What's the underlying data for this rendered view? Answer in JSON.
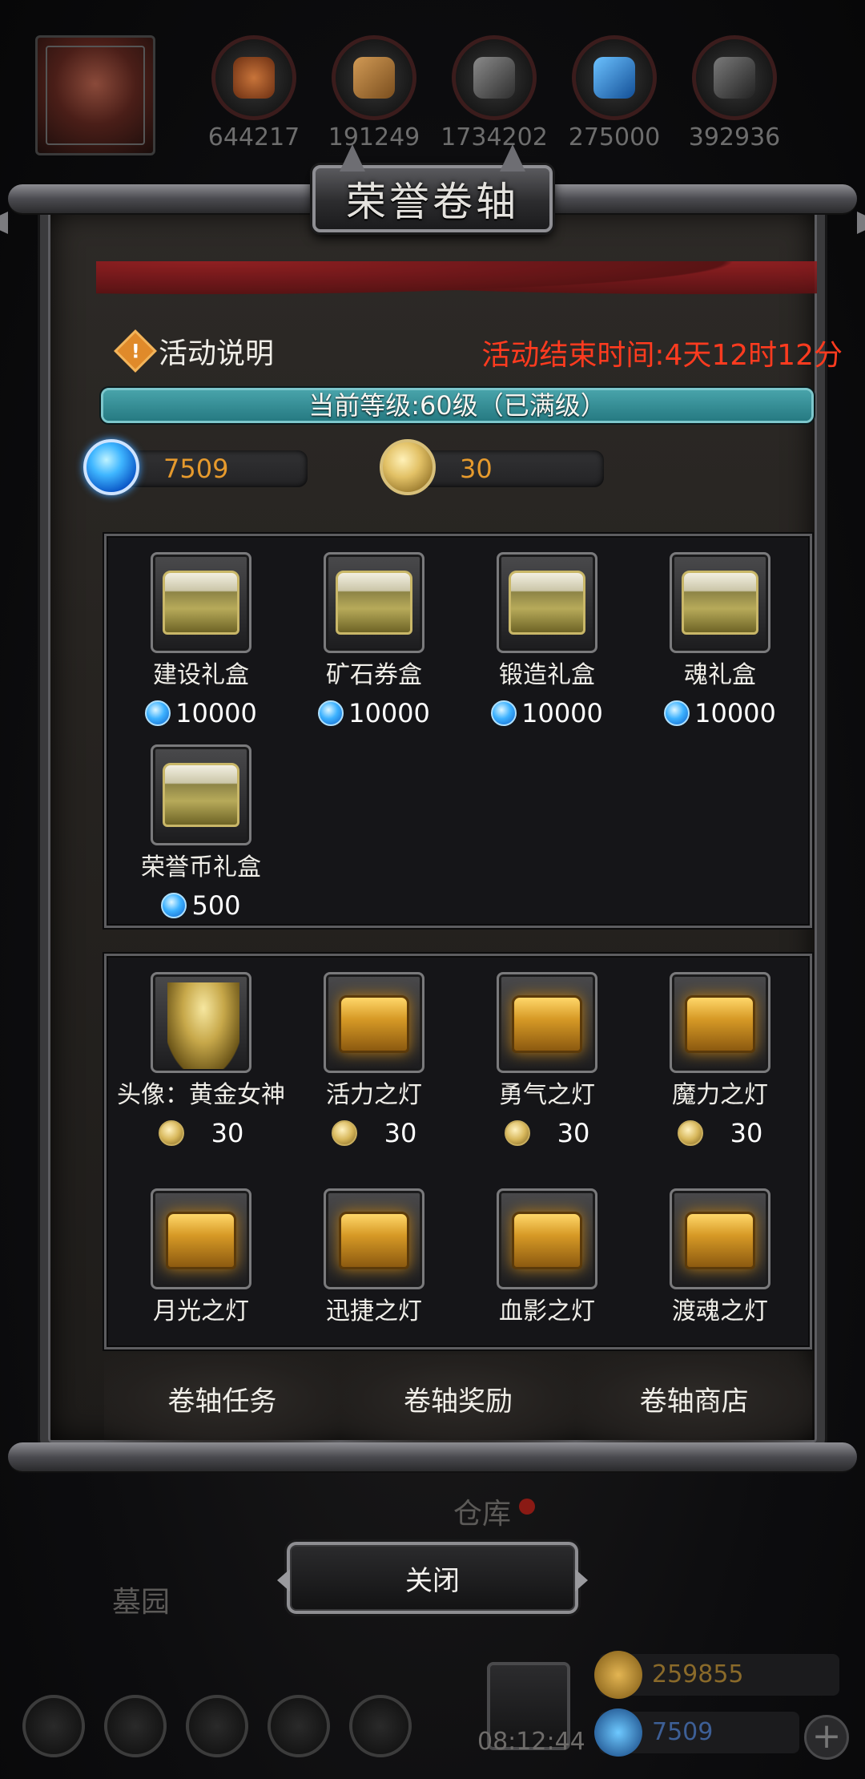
{
  "top_resources": [
    {
      "icon": "meat-icon",
      "value": "644217",
      "color": "#b05a2a"
    },
    {
      "icon": "wood-icon",
      "value": "191249",
      "color": "#a8793a"
    },
    {
      "icon": "iron-icon",
      "value": "1734202",
      "color": "#6b6b6b"
    },
    {
      "icon": "crystal-icon",
      "value": "275000",
      "color": "#3a8bd8"
    },
    {
      "icon": "steel-icon",
      "value": "392936",
      "color": "#5a5a5a"
    }
  ],
  "dialog": {
    "title": "荣誉卷轴",
    "info_label": "活动说明",
    "end_time": "活动结束时间:4天12时12分",
    "level_text": "当前等级:60级（已满级）",
    "level_progress": 1.0,
    "gems": "7509",
    "honor_coins": "30"
  },
  "gem_shop": [
    {
      "name": "建设礼盒",
      "price": "10000"
    },
    {
      "name": "矿石券盒",
      "price": "10000"
    },
    {
      "name": "锻造礼盒",
      "price": "10000"
    },
    {
      "name": "魂礼盒",
      "price": "10000"
    },
    {
      "name": "荣誉币礼盒",
      "price": "500"
    }
  ],
  "coin_shop": [
    {
      "name": "头像：黄金女神",
      "price": "30",
      "icon": "angel-statue-icon"
    },
    {
      "name": "活力之灯",
      "price": "30",
      "icon": "gold-chest-icon"
    },
    {
      "name": "勇气之灯",
      "price": "30",
      "icon": "gold-chest-icon"
    },
    {
      "name": "魔力之灯",
      "price": "30",
      "icon": "gold-chest-icon"
    },
    {
      "name": "月光之灯",
      "icon": "gold-chest-icon"
    },
    {
      "name": "迅捷之灯",
      "icon": "gold-chest-icon"
    },
    {
      "name": "血影之灯",
      "icon": "gold-chest-icon"
    },
    {
      "name": "渡魂之灯",
      "icon": "gold-chest-icon"
    }
  ],
  "tabs": [
    "卷轴任务",
    "卷轴奖励",
    "卷轴商店"
  ],
  "close_label": "关闭",
  "background": {
    "warehouse_label": "仓库",
    "cemetery_label": "墓园",
    "clock": "08:12:44",
    "bottom_gold": "259855",
    "bottom_gems": "7509"
  }
}
